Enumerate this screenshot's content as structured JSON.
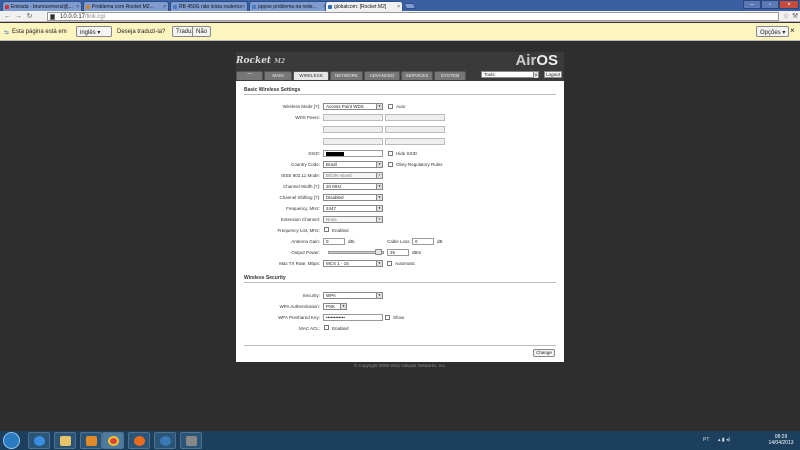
{
  "browser": {
    "tabs": [
      {
        "label": "Entrada - brunocemerul@..."
      },
      {
        "label": "Problema com Rocket M2..."
      },
      {
        "label": "RB 450G não inicia routeros"
      },
      {
        "label": "pppoe problema na rede..."
      },
      {
        "label": "globalcom: [Rocket M2]"
      }
    ],
    "url_host": "10.0.0.17",
    "url_path": "/link.cgi",
    "translate": {
      "prefix": "Esta página está em",
      "language": "inglês",
      "question": "Deseja traduzi-la?",
      "translate_btn": "Traduzir",
      "no_btn": "Não",
      "options_btn": "Opções"
    }
  },
  "header": {
    "rocket_logo": "Rocket",
    "rocket_model": "M2",
    "airos_air": "Air",
    "airos_os": "OS",
    "tabs": [
      "MAIN",
      "WIRELESS",
      "NETWORK",
      "ADVANCED",
      "SERVICES",
      "SYSTEM"
    ],
    "tools_value": "Tools:",
    "logout": "Logout"
  },
  "basic": {
    "title": "Basic Wireless Settings",
    "wireless_mode_label": "Wireless Mode [?]:",
    "wireless_mode_value": "Access Point WDS",
    "auto_label": "Auto",
    "wds_peers_label": "WDS Peers:",
    "ssid_label": "SSID:",
    "hide_ssid_label": "Hide SSID",
    "country_label": "Country Code:",
    "country_value": "Brazil",
    "obey_label": "Obey Regulatory Rules",
    "ieee_label": "IEEE 802.11 Mode:",
    "ieee_value": "B/G/N mixed",
    "width_label": "Channel Width [?]:",
    "width_value": "20 MHz",
    "shifting_label": "Channel Shifting [?]:",
    "shifting_value": "Disabled",
    "freq_label": "Frequency, MHz:",
    "freq_value": "2447",
    "ext_label": "Extension Channel:",
    "ext_value": "None",
    "freq_list_label": "Frequency List, MHz:",
    "enabled_label": "Enabled",
    "antenna_label": "Antenna Gain:",
    "antenna_value": "0",
    "dbi": "dBi",
    "cable_label": "Cable Loss:",
    "cable_value": "0",
    "db": "dB",
    "output_label": "Output Power:",
    "output_value": "26",
    "output_level": 0.95,
    "dbm": "dBm",
    "rate_label": "Max TX Rate, Mbps:",
    "rate_value": "MCS 1 - 15",
    "automatic_label": "Automatic"
  },
  "security": {
    "title": "Wireless Security",
    "security_label": "Security:",
    "security_value": "WPA",
    "auth_label": "WPA Authentication:",
    "auth_value": "PSK",
    "key_label": "WPA Preshared Key:",
    "key_value": "••••••••••••",
    "show_label": "Show",
    "mac_label": "MAC ACL:",
    "enabled_label": "Enabled"
  },
  "change_btn": "Change",
  "copyright": "© Copyright 2006-2011 Ubiquiti Networks, Inc.",
  "taskbar": {
    "lang": "PT",
    "time": "08:29",
    "date": "14/04/2013"
  }
}
